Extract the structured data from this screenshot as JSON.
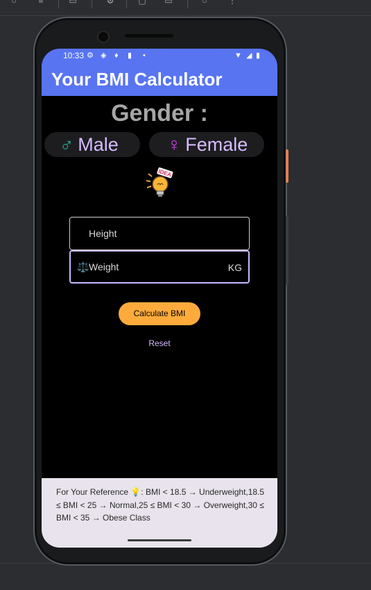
{
  "status_bar": {
    "time": "10:33"
  },
  "app": {
    "title": "Your BMI Calculator"
  },
  "gender": {
    "title": "Gender :",
    "male_symbol": "♂",
    "male_label": "Male",
    "female_symbol": "♀",
    "female_label": "Female"
  },
  "idea_icon": {
    "label": "IDEA"
  },
  "form": {
    "height_label": "Height",
    "weight_icon": "⚖️",
    "weight_label": "Weight",
    "weight_unit": "KG"
  },
  "actions": {
    "calculate_label": "Calculate BMI",
    "reset_label": "Reset"
  },
  "reference": {
    "text": "For Your Reference 💡: BMI < 18.5 → Underweight,18.5 ≤ BMI < 25 → Normal,25 ≤ BMI < 30 → Overweight,30 ≤ BMI < 35 → Obese Class"
  },
  "colors": {
    "app_bar": "#5874f1",
    "accent_text": "#d7bbff",
    "male_symbol": "#23b3a0",
    "female_symbol": "#e040fb",
    "calculate_button": "#ffab3c",
    "focus_border": "#c9b8ff",
    "reference_bg": "#e8e3ec"
  }
}
